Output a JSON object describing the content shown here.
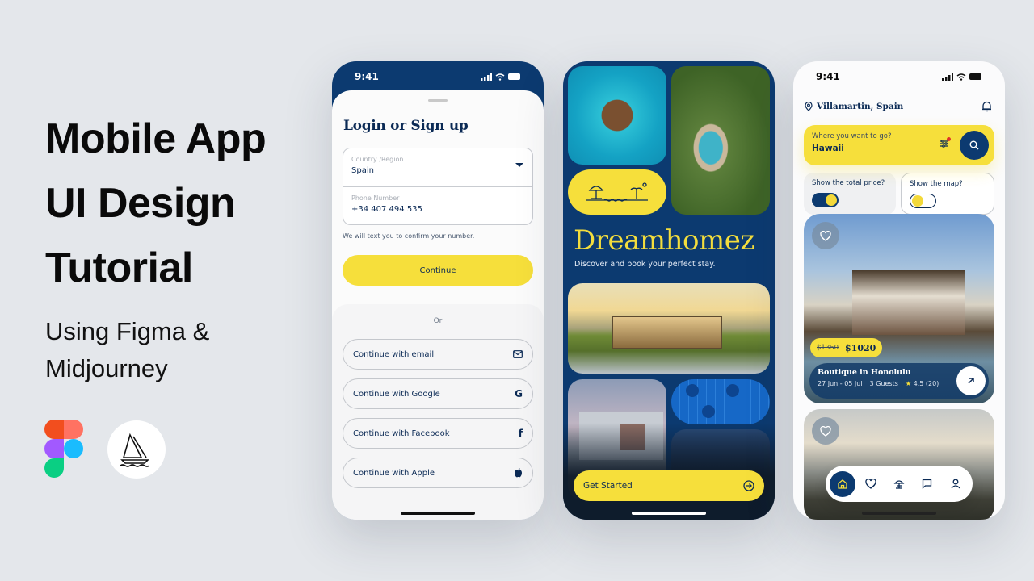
{
  "hero": {
    "title": "Mobile App UI Design Tutorial",
    "subtitle": "Using Figma & Midjourney",
    "logos": [
      "figma-logo",
      "midjourney-logo"
    ]
  },
  "colors": {
    "navy": "#0c3a70",
    "yellow": "#f6df3b",
    "background": "#e4e7eb"
  },
  "login_screen": {
    "status_time": "9:41",
    "title": "Login or Sign up",
    "country_label": "Country /Region",
    "country_value": "Spain",
    "phone_label": "Phone Number",
    "phone_value": "+34 407 494 535",
    "hint": "We will text you to confirm your number.",
    "continue_label": "Continue",
    "or_label": "Or",
    "social": [
      {
        "label": "Continue with email",
        "icon": "mail-icon"
      },
      {
        "label": "Continue with Google",
        "icon": "google-icon"
      },
      {
        "label": "Continue with Facebook",
        "icon": "facebook-icon"
      },
      {
        "label": "Continue with Apple",
        "icon": "apple-icon"
      }
    ]
  },
  "onboarding_screen": {
    "brand": "Dreamhomez",
    "tagline": "Discover and book your perfect stay.",
    "cta_label": "Get Started"
  },
  "home_screen": {
    "status_time": "9:41",
    "location": "Villamartin, Spain",
    "search_question": "Where you want to go?",
    "search_value": "Hawaii",
    "toggle_price_label": "Show the total price?",
    "toggle_price_on": true,
    "toggle_map_label": "Show the map?",
    "toggle_map_on": false,
    "listing": {
      "old_price": "$1350",
      "new_price": "$1020",
      "title": "Boutique in Honolulu",
      "dates": "27 Jun - 05 Jul",
      "guests": "3 Guests",
      "rating": "4.5 (20)"
    },
    "nav": [
      "home",
      "favorites",
      "bookings",
      "messages",
      "profile"
    ]
  }
}
